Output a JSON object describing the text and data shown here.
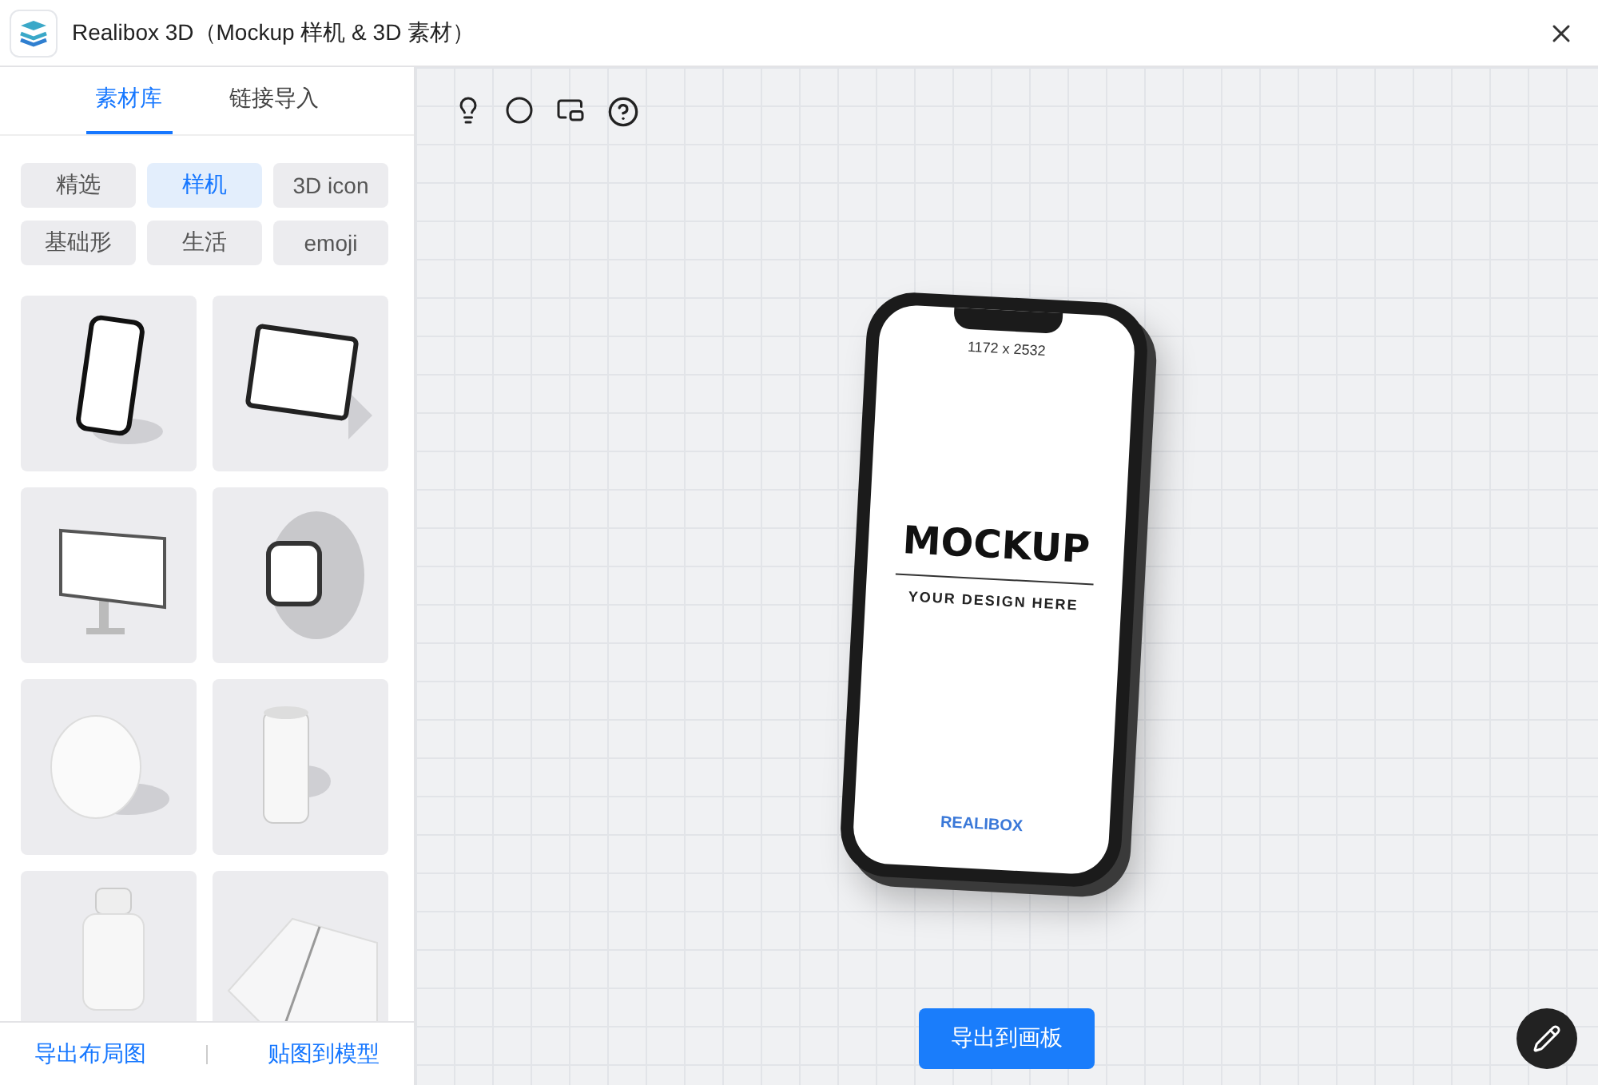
{
  "window": {
    "title": "Realibox 3D（Mockup 样机 & 3D 素材）"
  },
  "tabs": [
    {
      "label": "素材库",
      "selected": true
    },
    {
      "label": "链接导入",
      "selected": false
    }
  ],
  "categories": [
    {
      "label": "精选",
      "selected": false
    },
    {
      "label": "样机",
      "selected": true
    },
    {
      "label": "3D icon",
      "selected": false
    },
    {
      "label": "基础形",
      "selected": false
    },
    {
      "label": "生活",
      "selected": false
    },
    {
      "label": "emoji",
      "selected": false
    }
  ],
  "thumbnails": [
    {
      "kind": "phone"
    },
    {
      "kind": "tablet"
    },
    {
      "kind": "monitor"
    },
    {
      "kind": "watch"
    },
    {
      "kind": "disc"
    },
    {
      "kind": "can"
    },
    {
      "kind": "jar"
    },
    {
      "kind": "book"
    }
  ],
  "footer": {
    "actions": [
      "导出布局图",
      "贴图到模型"
    ]
  },
  "viewport": {
    "model": {
      "resolution": "1172 x 2532",
      "headline": "MOCKUP",
      "tagline": "YOUR DESIGN HERE",
      "brand": "REALIBOX"
    },
    "export_button": "导出到画板"
  }
}
